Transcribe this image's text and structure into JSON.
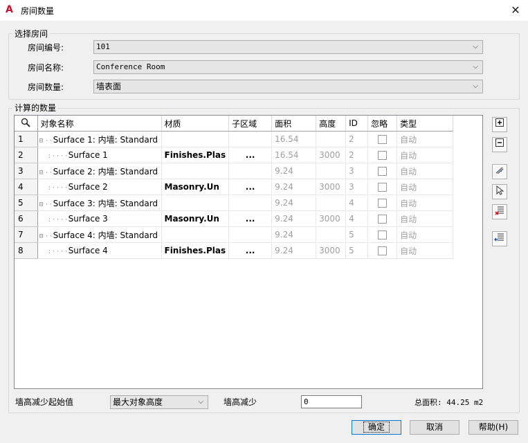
{
  "window": {
    "title": "房间数量",
    "app_icon_glyph": "A",
    "close_glyph": "✕"
  },
  "select_room": {
    "legend": "选择房间",
    "number_label": "房间编号:",
    "number_value": "101",
    "name_label": "房间名称:",
    "name_value": "Conference Room",
    "quantity_label": "房间数量:",
    "quantity_value": "墙表面"
  },
  "calc": {
    "legend": "计算的数量",
    "columns": [
      "对象名称",
      "材质",
      "子区域",
      "面积",
      "高度",
      "ID",
      "忽略",
      "类型"
    ],
    "rows": [
      {
        "num": "1",
        "name": "Surface 1: 内墙: Standard",
        "level": 0,
        "material": "",
        "sub": "",
        "area": "16.54",
        "height": "",
        "id": "2",
        "type": "自动"
      },
      {
        "num": "2",
        "name": "Surface 1",
        "level": 1,
        "material": "Finishes.Plas",
        "sub": "...",
        "area": "16.54",
        "height": "3000",
        "id": "2",
        "type": "自动"
      },
      {
        "num": "3",
        "name": "Surface 2: 内墙: Standard",
        "level": 0,
        "material": "",
        "sub": "",
        "area": "9.24",
        "height": "",
        "id": "3",
        "type": "自动"
      },
      {
        "num": "4",
        "name": "Surface 2",
        "level": 1,
        "material": "Masonry.Un",
        "sub": "...",
        "area": "9.24",
        "height": "3000",
        "id": "3",
        "type": "自动"
      },
      {
        "num": "5",
        "name": "Surface 3: 内墙: Standard",
        "level": 0,
        "material": "",
        "sub": "",
        "area": "9.24",
        "height": "",
        "id": "4",
        "type": "自动"
      },
      {
        "num": "6",
        "name": "Surface 3",
        "level": 1,
        "material": "Masonry.Un",
        "sub": "...",
        "area": "9.24",
        "height": "3000",
        "id": "4",
        "type": "自动"
      },
      {
        "num": "7",
        "name": "Surface 4: 内墙: Standard",
        "level": 0,
        "material": "",
        "sub": "",
        "area": "9.24",
        "height": "",
        "id": "5",
        "type": "自动"
      },
      {
        "num": "8",
        "name": "Surface 4",
        "level": 1,
        "material": "Finishes.Plas",
        "sub": "...",
        "area": "9.24",
        "height": "3000",
        "id": "5",
        "type": "自动"
      }
    ]
  },
  "footer": {
    "wall_reduce_start_label": "墙高减少起始值",
    "wall_reduce_start_value": "最大对象高度",
    "wall_reduce_label": "墙高减少",
    "wall_reduce_value": "0",
    "total_area": "总面积: 44.25 m2"
  },
  "buttons": {
    "ok": "确定",
    "cancel": "取消",
    "help": "帮助(H)"
  }
}
